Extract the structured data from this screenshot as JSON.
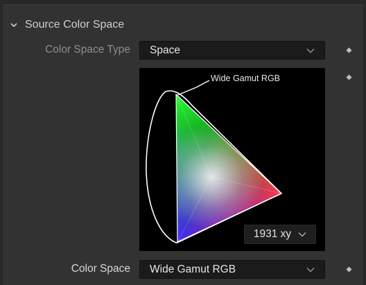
{
  "section": {
    "title": "Source Color Space"
  },
  "color_space_type": {
    "label": "Color Space Type",
    "value": "Space"
  },
  "diagram": {
    "gamut_label": "Wide Gamut RGB",
    "axes_mode": "1931 xy"
  },
  "color_space": {
    "label": "Color Space",
    "value": "Wide Gamut RGB"
  },
  "icons": {
    "section_toggle": "chevron-down-icon",
    "dropdown_caret": "chevron-down-icon",
    "keyframe": "diamond-icon"
  },
  "colors": {
    "panel_bg": "#323232",
    "field_bg": "#1b1b1b",
    "text": "#e6e6e6",
    "muted_text": "#8e8e8e"
  }
}
